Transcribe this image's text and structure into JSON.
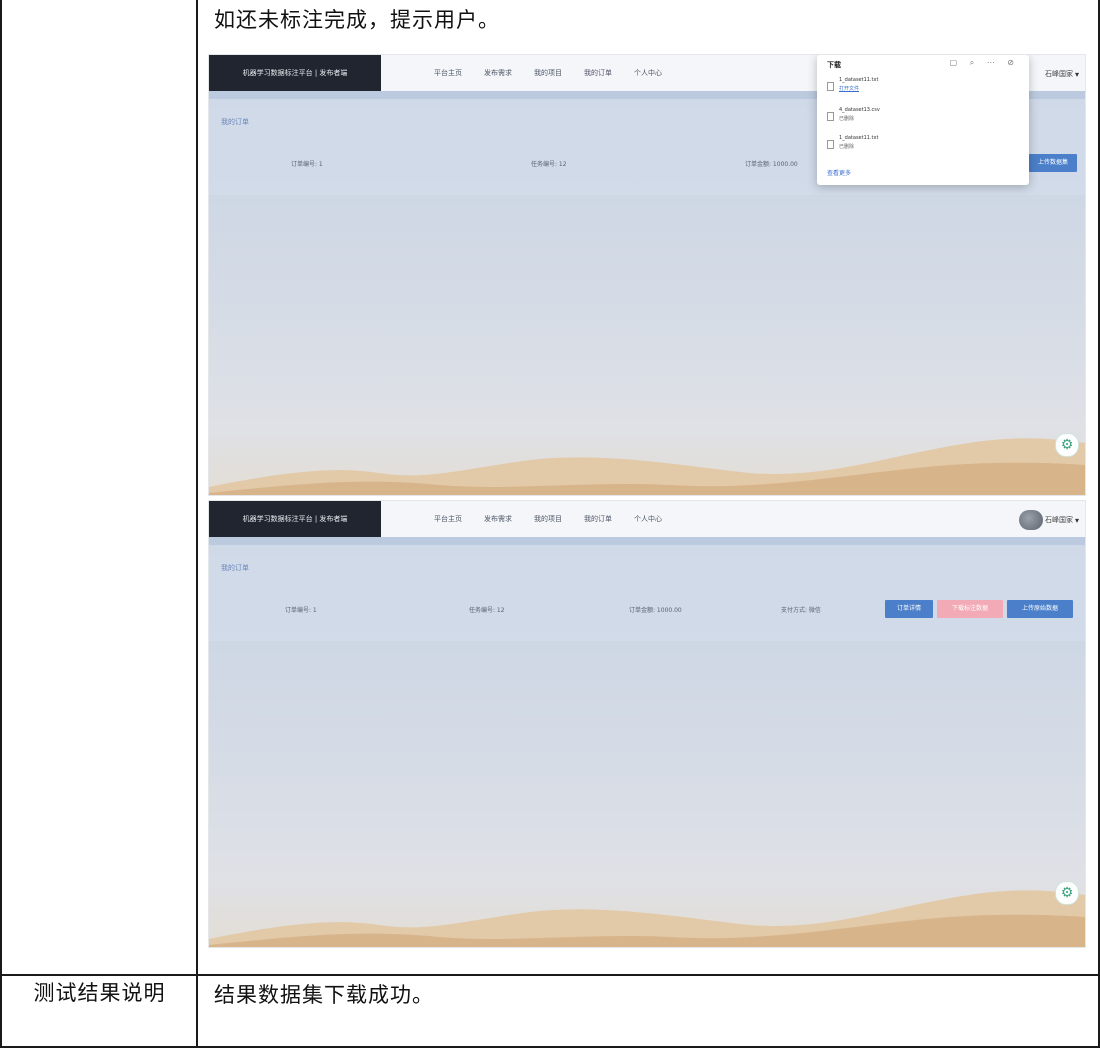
{
  "top_cell": {
    "text": "如还未标注完成，提示用户。"
  },
  "result_row": {
    "label": "测试结果说明",
    "value": "结果数据集下载成功。"
  },
  "screenshot_1": {
    "logo": "机器学习数据标注平台 | 发布者端",
    "nav": [
      "平台主页",
      "发布需求",
      "我的项目",
      "我的订单",
      "个人中心"
    ],
    "section_title": "我的订单",
    "order_no": "订单编号: 1",
    "task_no": "任务编号: 12",
    "amount": "订单金额: 1000.00",
    "user_name": "石峰国家",
    "button": "上传数据集",
    "download_panel": {
      "title": "下载",
      "icons": "▢ ⌕ ⋯ ⊘",
      "items": [
        {
          "name": "1_dataset11.txt",
          "status": "打开文件"
        },
        {
          "name": "4_dataset13.csv",
          "status": "已删除"
        },
        {
          "name": "1_dataset11.txt",
          "status": "已删除"
        }
      ],
      "more": "查看更多"
    }
  },
  "screenshot_2": {
    "logo": "机器学习数据标注平台 | 发布者端",
    "nav": [
      "平台主页",
      "发布需求",
      "我的项目",
      "我的订单",
      "个人中心"
    ],
    "section_title": "我的订单",
    "order_no": "订单编号: 1",
    "task_no": "任务编号: 12",
    "amount": "订单金额: 1000.00",
    "pay_method": "支付方式: 微信",
    "user_name": "石峰国家",
    "buttons": [
      "订单详情",
      "下载标注数据",
      "上传原始数据"
    ]
  }
}
